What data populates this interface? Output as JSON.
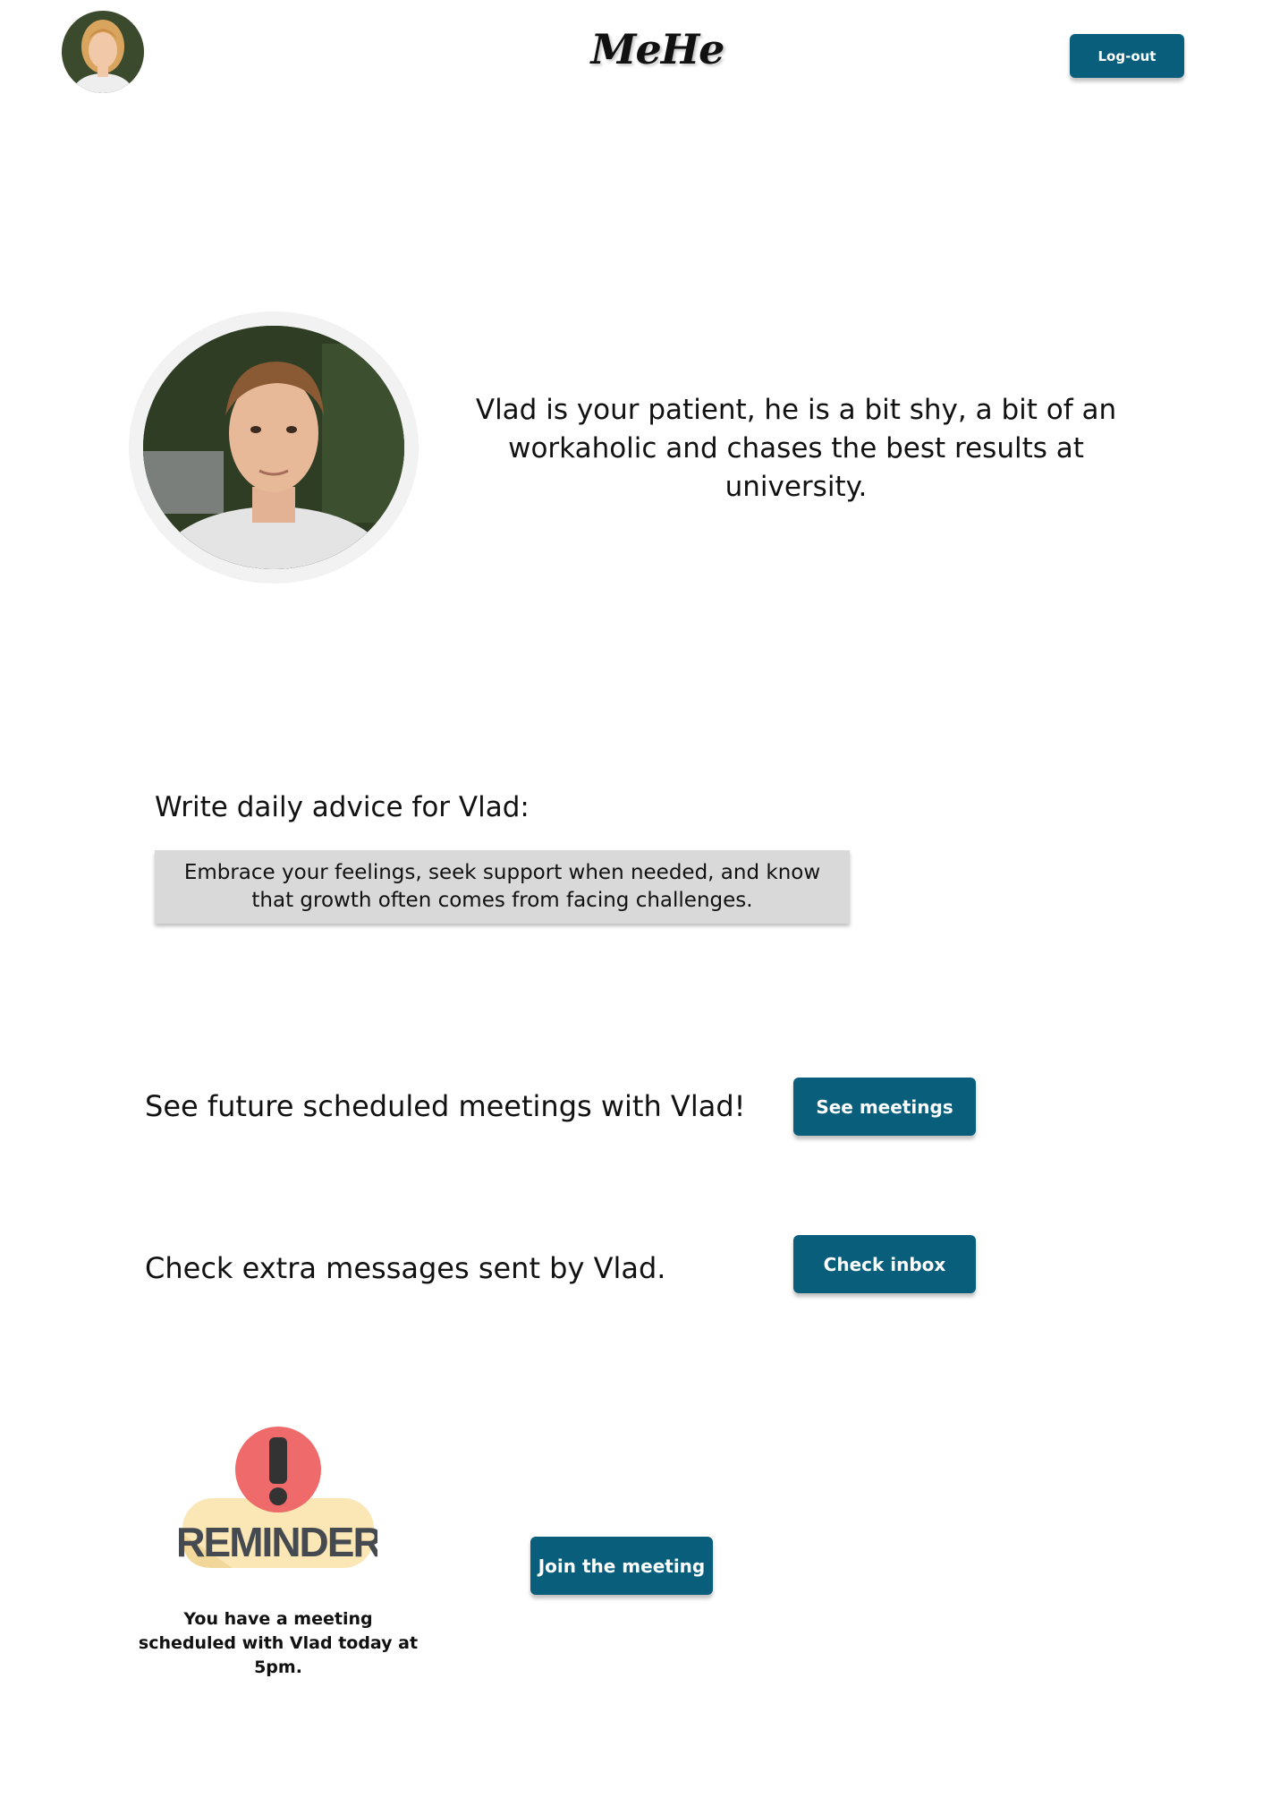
{
  "header": {
    "logo": "MeHe",
    "logout_label": "Log-out"
  },
  "profile": {
    "bio": "Vlad is your patient, he is a bit shy, a bit of an workaholic and chases the best results at university."
  },
  "advice": {
    "label": "Write daily advice for Vlad:",
    "value": "Embrace your feelings, seek support when needed, and know that growth often comes from facing challenges."
  },
  "meetings": {
    "text": "See future scheduled meetings with Vlad!",
    "button_label": "See meetings"
  },
  "inbox": {
    "text": "Check extra messages sent by Vlad.",
    "button_label": "Check inbox"
  },
  "reminder": {
    "badge_text": "REMINDER",
    "message": "You have a meeting scheduled with Vlad today at 5pm.",
    "join_label": "Join the meeting"
  },
  "colors": {
    "accent": "#095f7b",
    "advice_box": "#d9d9d9",
    "reminder_red": "#ef6b6b",
    "reminder_cream": "#fae7b5"
  }
}
